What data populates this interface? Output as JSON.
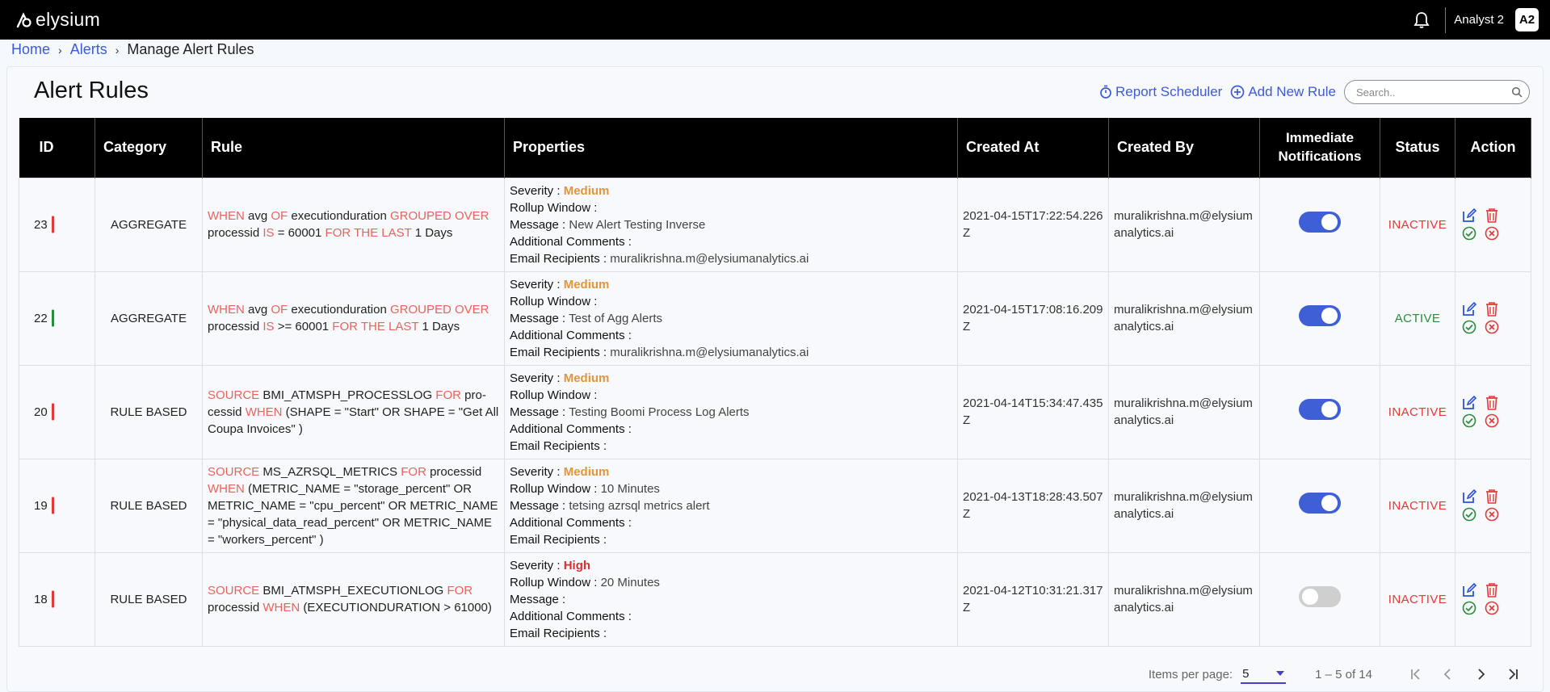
{
  "app": {
    "logo_text": "elysium"
  },
  "topbar": {
    "user_name": "Analyst 2",
    "avatar_initials": "A2"
  },
  "breadcrumb": {
    "home": "Home",
    "alerts": "Alerts",
    "current": "Manage Alert Rules"
  },
  "page": {
    "title": "Alert Rules"
  },
  "toolbar": {
    "report_scheduler": "Report Scheduler",
    "add_new_rule": "Add New Rule",
    "search_placeholder": "Search.."
  },
  "table": {
    "headers": {
      "id": "ID",
      "category": "Category",
      "rule": "Rule",
      "properties": "Properties",
      "created_at": "Created At",
      "created_by": "Created By",
      "immediate_1": "Immediate",
      "immediate_2": "Notifications",
      "status": "Status",
      "action": "Action"
    },
    "prop_labels": {
      "severity": "Severity :",
      "rollup": "Rollup Window :",
      "message": "Message :",
      "comments": "Additional Comments :",
      "recipients": "Email Recipients :"
    },
    "rows": [
      {
        "id": "23",
        "id_bar_color": "#e23b37",
        "category": "AGGREGATE",
        "rule": [
          {
            "t": "WHEN",
            "k": true
          },
          {
            "t": " avg ",
            "k": false
          },
          {
            "t": "OF",
            "k": true
          },
          {
            "t": " executionduration ",
            "k": false
          },
          {
            "t": "GROUPED OVER",
            "k": true
          },
          {
            "t": " processid ",
            "k": false
          },
          {
            "t": "IS",
            "k": true
          },
          {
            "t": " = 60001 ",
            "k": false
          },
          {
            "t": "FOR THE LAST",
            "k": true
          },
          {
            "t": " 1 Days",
            "k": false
          }
        ],
        "severity": "Medium",
        "severity_level": "medium",
        "rollup": "",
        "message": "New Alert Testing Inverse",
        "comments": "",
        "recipients": "muralikrishna.m@elysiumanalytics.ai",
        "created_at": "2021-04-15T17:22:54.226Z",
        "created_by": "muralikrishna.m@elysiumanalytics.ai",
        "notifications_on": true,
        "status": "INACTIVE"
      },
      {
        "id": "22",
        "id_bar_color": "#2a8b3a",
        "category": "AGGREGATE",
        "rule": [
          {
            "t": "WHEN",
            "k": true
          },
          {
            "t": " avg ",
            "k": false
          },
          {
            "t": "OF",
            "k": true
          },
          {
            "t": " executionduration ",
            "k": false
          },
          {
            "t": "GROUPED OVER",
            "k": true
          },
          {
            "t": " processid ",
            "k": false
          },
          {
            "t": "IS",
            "k": true
          },
          {
            "t": " >= 60001 ",
            "k": false
          },
          {
            "t": "FOR THE LAST",
            "k": true
          },
          {
            "t": " 1 Days",
            "k": false
          }
        ],
        "severity": "Medium",
        "severity_level": "medium",
        "rollup": "",
        "message": "Test of Agg Alerts",
        "comments": "",
        "recipients": "muralikrishna.m@elysiumanalytics.ai",
        "created_at": "2021-04-15T17:08:16.209Z",
        "created_by": "muralikrishna.m@elysiumanalytics.ai",
        "notifications_on": true,
        "status": "ACTIVE"
      },
      {
        "id": "20",
        "id_bar_color": "#e23b37",
        "category": "RULE BASED",
        "rule": [
          {
            "t": "SOURCE",
            "k": true
          },
          {
            "t": " BMI_ATMSPH_PROCESSLOG ",
            "k": false
          },
          {
            "t": "FOR",
            "k": true
          },
          {
            "t": " pro-cessid ",
            "k": false
          },
          {
            "t": "WHEN",
            "k": true
          },
          {
            "t": " (SHAPE = \"Start\" OR SHAPE = \"Get All Coupa Invoices\" )",
            "k": false
          }
        ],
        "severity": "Medium",
        "severity_level": "medium",
        "rollup": "",
        "message": "Testing Boomi Process Log Alerts",
        "comments": "",
        "recipients": "",
        "created_at": "2021-04-14T15:34:47.435Z",
        "created_by": "muralikrishna.m@elysiumanalytics.ai",
        "notifications_on": true,
        "status": "INACTIVE"
      },
      {
        "id": "19",
        "id_bar_color": "#e23b37",
        "category": "RULE BASED",
        "rule": [
          {
            "t": "SOURCE",
            "k": true
          },
          {
            "t": " MS_AZRSQL_METRICS ",
            "k": false
          },
          {
            "t": "FOR",
            "k": true
          },
          {
            "t": " processid ",
            "k": false
          },
          {
            "t": "WHEN",
            "k": true
          },
          {
            "t": " (METRIC_NAME = \"storage_percent\" OR METRIC_NAME = \"cpu_percent\" OR METRIC_NAME = \"physical_data_read_percent\" OR METRIC_NAME = \"workers_percent\" )",
            "k": false
          }
        ],
        "severity": "Medium",
        "severity_level": "medium",
        "rollup": "10 Minutes",
        "message": "tetsing azrsql metrics alert",
        "comments": "",
        "recipients": "",
        "created_at": "2021-04-13T18:28:43.507Z",
        "created_by": "muralikrishna.m@elysiumanalytics.ai",
        "notifications_on": true,
        "status": "INACTIVE"
      },
      {
        "id": "18",
        "id_bar_color": "#e23b37",
        "category": "RULE BASED",
        "rule": [
          {
            "t": "SOURCE",
            "k": true
          },
          {
            "t": " BMI_ATMSPH_EXECUTIONLOG ",
            "k": false
          },
          {
            "t": "FOR",
            "k": true
          },
          {
            "t": " processid ",
            "k": false
          },
          {
            "t": "WHEN",
            "k": true
          },
          {
            "t": " (EXECUTIONDURATION > 61000)",
            "k": false
          }
        ],
        "severity": "High",
        "severity_level": "high",
        "rollup": "20 Minutes",
        "message": "",
        "comments": "",
        "recipients": "",
        "created_at": "2021-04-12T10:31:21.317Z",
        "created_by": "muralikrishna.m@elysiumanalytics.ai",
        "notifications_on": false,
        "status": "INACTIVE"
      }
    ]
  },
  "pagination": {
    "items_per_page_label": "Items per page:",
    "items_per_page_value": "5",
    "range_text": "1 – 5 of 14"
  },
  "colors": {
    "accent": "#3b5bdb",
    "keyword": "#e8645a",
    "inactive": "#e23b37",
    "active": "#2a8b3a",
    "edit_icon": "#2a52d9",
    "delete_icon": "#e23b37",
    "approve_icon": "#2a8b3a"
  },
  "icons": {
    "logo": "elysium-logo-icon",
    "bell": "bell-icon",
    "report_scheduler": "stopwatch-icon",
    "add": "plus-circle-icon",
    "search": "search-icon",
    "edit": "edit-icon",
    "delete": "trash-icon",
    "approve": "check-circle-icon",
    "reject": "x-circle-icon"
  }
}
